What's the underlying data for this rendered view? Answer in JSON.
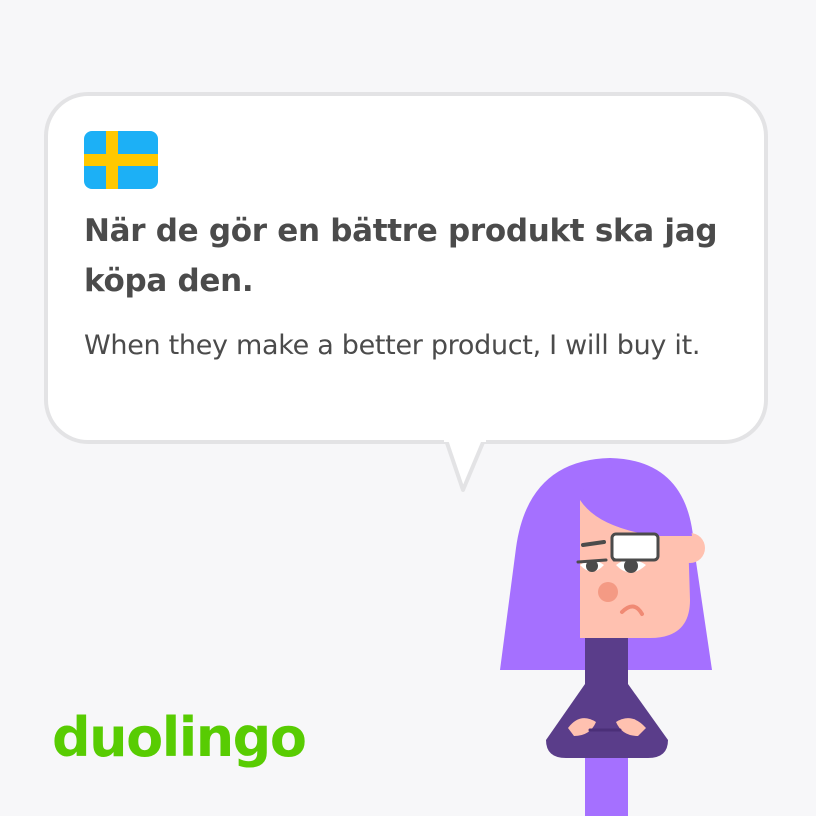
{
  "card": {
    "flag_icon": "sweden-flag-icon",
    "sentence": "När de gör en bättre produkt ska jag köpa den.",
    "translation": "When they make a better product, I will buy it."
  },
  "brand": {
    "logo_text": "duolingo"
  },
  "character_icon": "lily-character-arms-crossed",
  "colors": {
    "background": "#f7f7f9",
    "bubble": "#ffffff",
    "bubble_border": "#e3e3e5",
    "text": "#4b4b4b",
    "brand_green": "#58cc02",
    "flag_blue": "#1cb0f6",
    "flag_yellow": "#ffc800",
    "hair": "#a570ff",
    "skin": "#ffc1b0",
    "shirt": "#5a3d8a"
  }
}
